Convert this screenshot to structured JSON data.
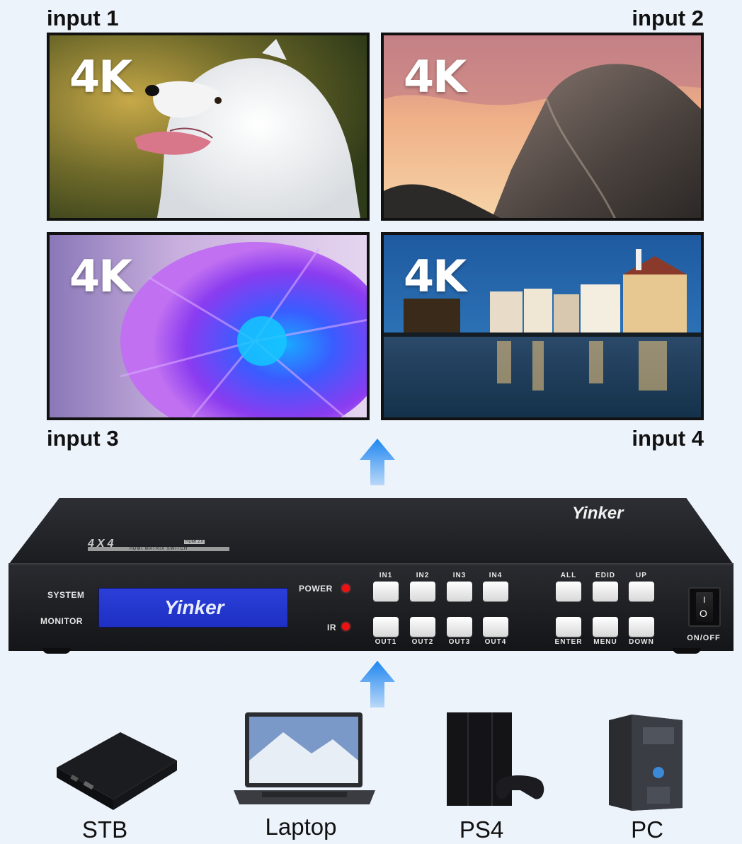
{
  "screens": [
    {
      "label": "input 1",
      "badge": "4K"
    },
    {
      "label": "input 2",
      "badge": "4K"
    },
    {
      "label": "input 3",
      "badge": "4K"
    },
    {
      "label": "input 4",
      "badge": "4K"
    }
  ],
  "device": {
    "brand": "Yinker",
    "model_badge": "4X4",
    "badge_small": "HDMI 2.0",
    "badge_sub": "HDMI MATRIX SWITCH",
    "lcd_text": "Yinker",
    "system_label": "SYSTEM",
    "monitor_label": "MONITOR",
    "power_label": "POWER",
    "ir_label": "IR",
    "input_buttons": [
      "IN1",
      "IN2",
      "IN3",
      "IN4"
    ],
    "output_buttons": [
      "OUT1",
      "OUT2",
      "OUT3",
      "OUT4"
    ],
    "control_top": [
      "ALL",
      "EDID",
      "UP"
    ],
    "control_bottom": [
      "ENTER",
      "MENU",
      "DOWN"
    ],
    "switch_on": "I",
    "switch_off": "O",
    "onoff_label": "ON/OFF"
  },
  "sources": [
    "STB",
    "Laptop",
    "PS4",
    "PC"
  ],
  "colors": {
    "arrow": "#1f86f0",
    "lcd": "#2438d0",
    "led": "#e11111"
  }
}
